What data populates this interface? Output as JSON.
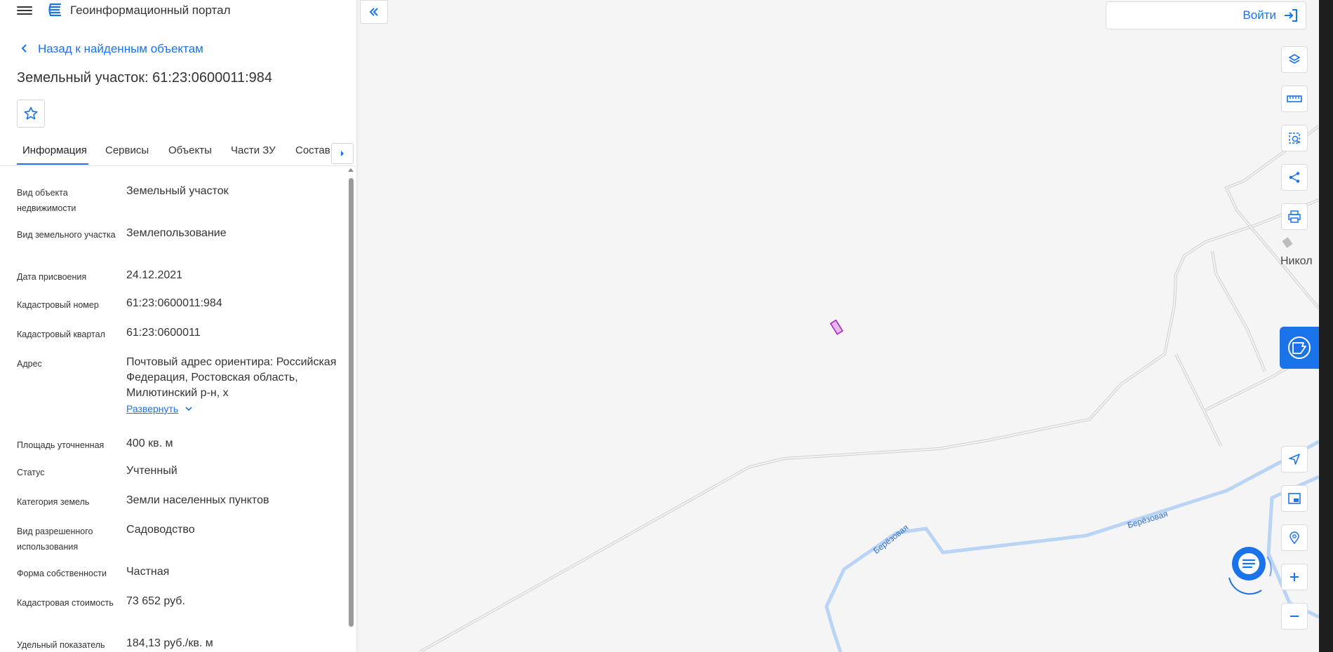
{
  "app": {
    "title": "Геоинформационный портал"
  },
  "navigation": {
    "back_label": "Назад к найденным объектам"
  },
  "object": {
    "title": "Земельный участок: 61:23:0600011:984"
  },
  "tabs": [
    {
      "label": "Информация",
      "active": true
    },
    {
      "label": "Сервисы",
      "active": false
    },
    {
      "label": "Объекты",
      "active": false
    },
    {
      "label": "Части ЗУ",
      "active": false
    },
    {
      "label": "Состав",
      "active": false
    }
  ],
  "properties": [
    {
      "label": "Вид объекта недвижимости",
      "value": "Земельный участок"
    },
    {
      "label": "Вид земельного участка",
      "value": "Землепользование"
    },
    {
      "label": "Дата присвоения",
      "value": "24.12.2021"
    },
    {
      "label": "Кадастровый номер",
      "value": "61:23:0600011:984"
    },
    {
      "label": "Кадастровый квартал",
      "value": "61:23:0600011"
    },
    {
      "label": "Адрес",
      "value": "Почтовый адрес ориентира: Российская Федерация, Ростовская область, Милютинский р-н, х"
    },
    {
      "label": "Площадь уточненная",
      "value": "400 кв. м"
    },
    {
      "label": "Статус",
      "value": "Учтенный"
    },
    {
      "label": "Категория земель",
      "value": "Земли населенных пунктов"
    },
    {
      "label": "Вид разрешенного использования",
      "value": "Садоводство"
    },
    {
      "label": "Форма собственности",
      "value": "Частная"
    },
    {
      "label": "Кадастровая стоимость",
      "value": "73 652 руб."
    },
    {
      "label": "Удельный показатель",
      "value": "184,13 руб./кв. м"
    }
  ],
  "address_expand_label": "Развернуть",
  "map": {
    "login_label": "Войти",
    "place_label": "Никол",
    "street_labels": [
      "Берёзовая",
      "Берёзовая"
    ],
    "colors": {
      "background": "#f5f5f5",
      "road": "#c8c8c8",
      "street": "#b9d4f5",
      "parcel": "#a020c0",
      "accent": "#1a73e8"
    }
  },
  "icons": {
    "menu": "menu-icon",
    "logo": "logo-icon",
    "back": "chevron-left-icon",
    "favorite": "star-icon",
    "collapse": "double-chevron-left-icon",
    "login": "login-icon",
    "layers": "layers-icon",
    "ruler": "ruler-icon",
    "select": "area-select-icon",
    "share": "share-icon",
    "print": "print-icon",
    "navigate": "navigation-arrow-icon",
    "minimap": "minimap-icon",
    "locate": "location-search-icon",
    "zoom_in": "plus-icon",
    "zoom_out": "minus-icon",
    "chat": "chat-icon",
    "side_tab": "map-tab-icon"
  }
}
